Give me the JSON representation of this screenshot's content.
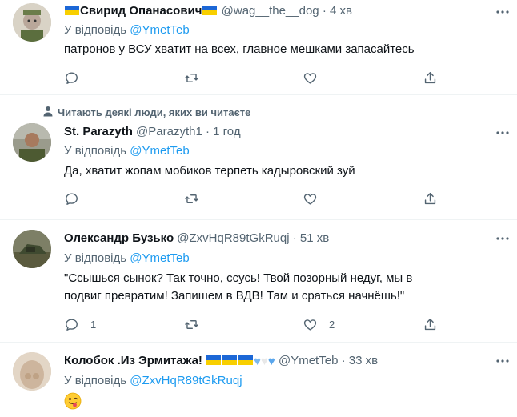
{
  "tweets": [
    {
      "name": "Свирид Опанасович",
      "handle": "@wag__the__dog",
      "dot": "·",
      "time": "4 хв",
      "reply_prefix": "У відповідь",
      "reply_to": "@YmetTeb",
      "text": "патронов у ВСУ хватит на всех, главное мешками запасайтесь",
      "counts": {
        "reply": "",
        "retweet": "",
        "like": ""
      }
    },
    {
      "name": "St. Parazyth",
      "handle": "@Parazyth1",
      "dot": "·",
      "time": "1 год",
      "reply_prefix": "У відповідь",
      "reply_to": "@YmetTeb",
      "text": "Да, хватит жопам мобиков терпеть кадыровский зуй",
      "counts": {
        "reply": "",
        "retweet": "",
        "like": ""
      }
    },
    {
      "name": "Олександр Бузько",
      "handle": "@ZxvHqR89tGkRuqj",
      "dot": "·",
      "time": "51 хв",
      "reply_prefix": "У відповідь",
      "reply_to": "@YmetTeb",
      "text": "\"Ссышься сынок? Так точно, ссусь! Твой позорный недуг, мы в подвиг превратим! Запишем в ВДВ! Там и сраться начнёшь!\"",
      "counts": {
        "reply": "1",
        "retweet": "",
        "like": "2"
      }
    },
    {
      "name": "Колобок .Из Эрмитажа!",
      "handle": "@YmetTeb",
      "dot": "·",
      "time": "33 хв",
      "reply_prefix": "У відповідь",
      "reply_to": "@ZxvHqR89tGkRuqj",
      "text": ""
    }
  ],
  "social_context": "Читають деякі люди, яких ви читаєте",
  "icons": [
    "user-icon",
    "reply-icon",
    "retweet-icon",
    "like-icon",
    "share-icon",
    "more-icon"
  ],
  "colors": {
    "accent": "#1d9bf0",
    "muted": "#536471",
    "text": "#0f1419",
    "divider": "#eff3f4"
  }
}
